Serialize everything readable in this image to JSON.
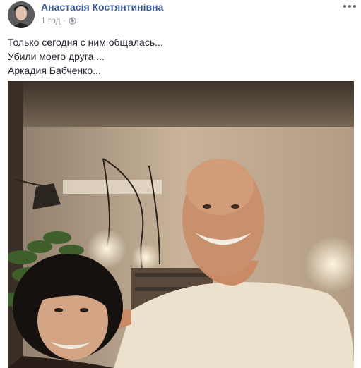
{
  "post": {
    "author_name": "Анастасія Костянтинівна",
    "timestamp": "1 год",
    "separator": "·",
    "privacy_icon": "globe-icon",
    "more_icon": "more-options-icon",
    "text_lines": [
      "Только сегодня с ним общалась...",
      "Убили моего друга....",
      "Аркадия Бабченко..."
    ],
    "photo_icon": "post-photo"
  }
}
